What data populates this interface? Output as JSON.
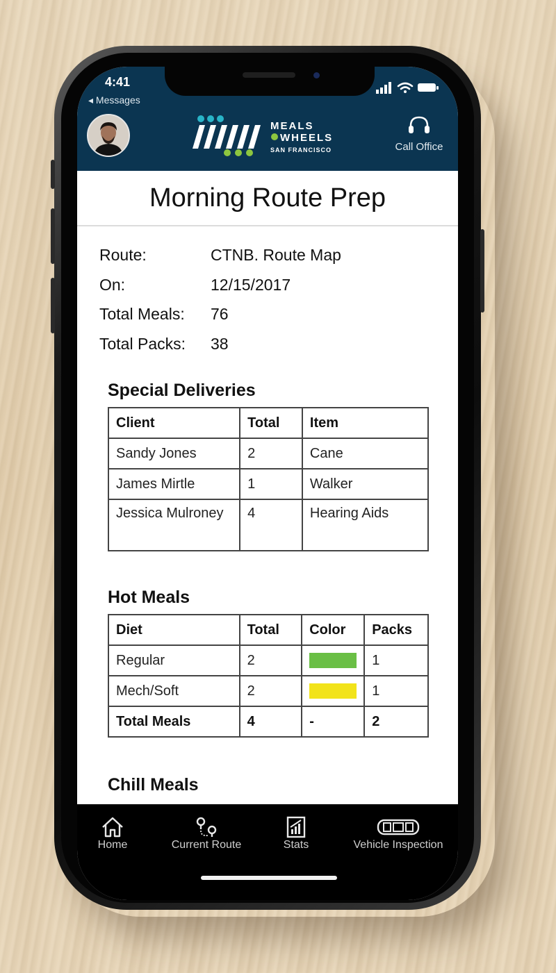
{
  "status_bar": {
    "time": "4:41",
    "back_label": "◂ Messages"
  },
  "header": {
    "logo_text_1": "MEALS",
    "logo_text_2": "WHEELS",
    "logo_text_3": "SAN FRANCISCO",
    "call_office_label": "Call Office"
  },
  "page_title": "Morning Route Prep",
  "route_info": [
    {
      "key": "Route:",
      "value": "CTNB. Route Map"
    },
    {
      "key": "On:",
      "value": "12/15/2017"
    },
    {
      "key": "Total Meals:",
      "value": "76"
    },
    {
      "key": "Total Packs:",
      "value": "38"
    }
  ],
  "special_deliveries": {
    "title": "Special Deliveries",
    "columns": [
      "Client",
      "Total",
      "Item"
    ],
    "rows": [
      [
        "Sandy Jones",
        "2",
        "Cane"
      ],
      [
        "James Mirtle",
        "1",
        "Walker"
      ],
      [
        "Jessica Mulroney",
        "4",
        "Hearing Aids"
      ]
    ]
  },
  "hot_meals": {
    "title": "Hot Meals",
    "columns": [
      "Diet",
      "Total",
      "Color",
      "Packs"
    ],
    "rows": [
      {
        "diet": "Regular",
        "total": "2",
        "color": "#6abf45",
        "packs": "1"
      },
      {
        "diet": "Mech/Soft",
        "total": "2",
        "color": "#f2e31a",
        "packs": "1"
      }
    ],
    "total_row": {
      "diet": "Total Meals",
      "total": "4",
      "color": "-",
      "packs": "2"
    }
  },
  "chill_meals": {
    "title": "Chill Meals"
  },
  "tabbar": {
    "home": "Home",
    "current_route": "Current Route",
    "stats": "Stats",
    "vehicle_inspection": "Vehicle Inspection"
  },
  "colors": {
    "header_bg": "#0b3551",
    "logo_teal": "#28b4c8",
    "logo_green": "#8dc63f"
  }
}
